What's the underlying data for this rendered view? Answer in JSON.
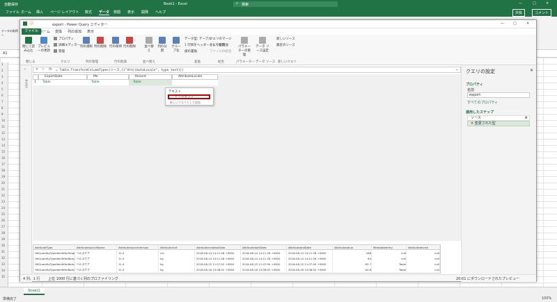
{
  "excel": {
    "autosave": "自動保存",
    "title": "Book1 - Excel",
    "search": "検索",
    "tabs": [
      "ファイル",
      "ホーム",
      "挿入",
      "ページ レイアウト",
      "数式",
      "データ",
      "校閲",
      "表示",
      "開発",
      "ヘルプ"
    ],
    "share": "共有",
    "comment": "コメント",
    "name_box": "A1",
    "rows": [
      "1",
      "2",
      "3",
      "4",
      "5",
      "6",
      "7",
      "8",
      "9",
      "10",
      "11",
      "12",
      "13",
      "14",
      "15",
      "16",
      "17",
      "18",
      "19",
      "20",
      "21",
      "22",
      "23",
      "24",
      "25",
      "26",
      "27",
      "28",
      "29",
      "30",
      "31",
      "32",
      "33",
      "34",
      "35"
    ],
    "sheet_tab": "Sheet1",
    "status_left": "準備完了",
    "status_right": "100%",
    "ribbon_left": "データの取得 ~"
  },
  "pq": {
    "title": "export - Power Query エディター",
    "tabs": [
      "ファイル",
      "ホーム",
      "変換",
      "列の追加",
      "表示"
    ],
    "ribbon": {
      "close_apply": "閉じて読み込む",
      "preview_refresh": "プレビューの更新",
      "properties": "プロパティ",
      "advanced_editor": "詳細エディター",
      "manage": "管理",
      "choose_columns": "列の選択",
      "remove_columns": "列の削除",
      "keep_rows": "行の保持",
      "remove_rows": "行の削除",
      "sort": "並べ替え",
      "split_column": "列の分割",
      "group_by": "グループ化",
      "data_type": "データ型: テーブル",
      "first_row_header": "1 行目をヘッダーとして使用",
      "replace_values": "値の置換",
      "merge_queries": "クエリのマージ",
      "append_queries": "クエリの追加",
      "combine_files": "ファイルの結合",
      "parameters": "パラメーターの管理",
      "data_source_settings": "データ ソース設定",
      "new_source": "新しいソース",
      "recent_sources": "最近のソース",
      "groups": [
        "閉じる",
        "クエリ",
        "列の管理",
        "行の削減",
        "並べ替え",
        "変換",
        "結合",
        "パラメーター",
        "データ ソース",
        "新しいクエリ"
      ]
    },
    "formula": "= Table.TransformColumnTypes(ソース,{{\"AttributeLocale\", type text}})",
    "queries_label": "クエリ",
    "columns": [
      "ExportDate",
      "Me",
      "Record",
      "AttributeLocale"
    ],
    "row": [
      "Table",
      "Table",
      "Table",
      ""
    ],
    "row_number": "1",
    "dropdown": {
      "item1": "テキスト",
      "item2": "ドリルダウン",
      "item3": "新しいクエリとして追加"
    },
    "preview": {
      "headers": [
        "AttributeType",
        "AttributesourceName",
        "AttributesourceVersion",
        "AttributeUnit",
        "AttributecreationDate",
        "AttributestartDate",
        "AttributeendDate",
        "Attributevalue",
        "Metadataentry",
        "Attributedevice"
      ],
      "rows": [
        [
          "HKQuantityTypeIdentifierHeight",
          "ヘルスケア",
          "11.4",
          "cm",
          "2018-08-14 14:11:28 +0900",
          "2018-08-14 14:11:28 +0900",
          "2018-08-14 14:11:28 +0900",
          "168",
          "null",
          "null"
        ],
        [
          "HKQuantityTypeIdentifierBodyMass",
          "ヘルスケア",
          "11.4",
          "kg",
          "2018-08-14 14:11:28 +0900",
          "2018-08-14 14:11:28 +0900",
          "2018-08-14 14:11:28 +0900",
          "64",
          "null",
          "null"
        ],
        [
          "HKQuantityTypeIdentifierBodyMass",
          "ヘルスケア",
          "11.4",
          "kg",
          "2018-08-15 11:07:02 +0900",
          "2018-08-15 11:07:00 +0900",
          "2018-08-15 11:07:00 +0900",
          "63.7",
          "Table",
          "null"
        ],
        [
          "HKQuantityTypeIdentifierBodyMass",
          "ヘルスケア",
          "11.4",
          "kg",
          "2018-08-16 13:08:22 +0900",
          "2018-08-16 13:08:02 +0900",
          "2018-08-16 13:08:02 +0900",
          "63.8",
          "Table",
          "null"
        ]
      ]
    },
    "status_left": "4 列、1 行",
    "status_mid": "上位 1000 行に基づく列のプロファイリング",
    "status_right": "20:01 にダウンロードされたプレビュー"
  },
  "query_settings": {
    "title": "クエリの設定",
    "properties": "プロパティ",
    "name_label": "名前",
    "name_value": "export",
    "all_properties": "すべてのプロパティ",
    "applied_steps": "適用したステップ",
    "steps": [
      "ソース",
      "変更された型"
    ]
  },
  "colors": {
    "excel_green": "#217346",
    "highlight_red": "#c00000"
  }
}
